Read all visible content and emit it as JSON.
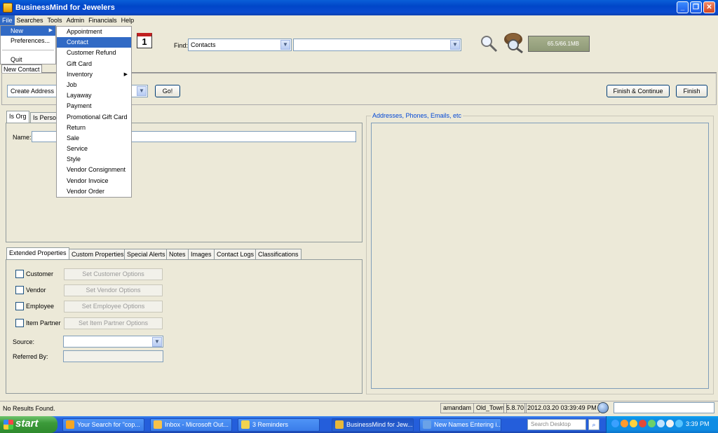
{
  "window": {
    "title": "BusinessMind for Jewelers"
  },
  "menubar": {
    "items": [
      "File",
      "Searches",
      "Tools",
      "Admin",
      "Financials",
      "Help"
    ]
  },
  "file_menu": {
    "items": [
      "New",
      "Preferences...",
      "Quit"
    ]
  },
  "new_menu": {
    "items": [
      "Appointment",
      "Contact",
      "Customer Refund",
      "Gift Card",
      "Inventory",
      "Job",
      "Layaway",
      "Payment",
      "Promotional Gift Card",
      "Return",
      "Sale",
      "Service",
      "Style",
      "Vendor Consignment",
      "Vendor Invoice",
      "Vendor Order"
    ],
    "selected": "Contact"
  },
  "toolbar": {
    "calendar_day": "1",
    "find_label": "Find:",
    "find_type": "Contacts",
    "find_query": "",
    "memory": "65.5/66.1MB"
  },
  "doc_tab": {
    "label": "New Contact"
  },
  "actions": {
    "create_select": "Create Address",
    "go": "Go!",
    "finish_continue": "Finish & Continue",
    "finish": "Finish"
  },
  "entity_tabs": [
    "Is Org",
    "Is Perso"
  ],
  "form": {
    "name_label": "Name:",
    "name_value": ""
  },
  "prop_tabs": [
    "Extended Properties",
    "Custom Properties",
    "Special Alerts",
    "Notes",
    "Images",
    "Contact Logs",
    "Classifications"
  ],
  "roles": [
    {
      "label": "Customer",
      "button": "Set Customer Options"
    },
    {
      "label": "Vendor",
      "button": "Set Vendor Options"
    },
    {
      "label": "Employee",
      "button": "Set Employee Options"
    },
    {
      "label": "Item Partner",
      "button": "Set Item Partner Options"
    }
  ],
  "source": {
    "label": "Source:",
    "value": ""
  },
  "referred": {
    "label": "Referred By:",
    "value": ""
  },
  "right_panel": {
    "title": "Addresses, Phones, Emails, etc"
  },
  "status": {
    "message": "No Results Found.",
    "user": "amandam",
    "location": "Old_Town",
    "version": "5.8.70",
    "datetime": "2012.03.20 03:39:49 PM"
  },
  "taskbar": {
    "start": "start",
    "tasks": [
      "Your Search for \"cop...",
      "Inbox - Microsoft Out...",
      "3 Reminders",
      "BusinessMind for Jew...",
      "New Names Entering i..."
    ],
    "search_placeholder": "Search Desktop",
    "clock": "3:39 PM"
  },
  "colors": {
    "selection": "#316ac5",
    "titlebar": "#0046c8",
    "taskbar": "#245edb"
  }
}
